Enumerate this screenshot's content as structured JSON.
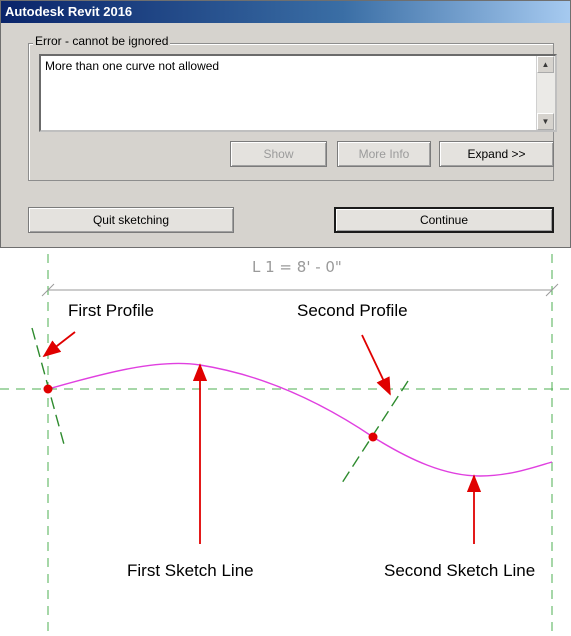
{
  "dialog": {
    "title": "Autodesk Revit 2016",
    "group_label": "Error - cannot be ignored",
    "message": "More than one curve not allowed",
    "scroll_up_glyph": "▲",
    "scroll_down_glyph": "▼",
    "buttons": {
      "show": "Show",
      "more_info": "More Info",
      "expand": "Expand >>",
      "quit_sketching": "Quit sketching",
      "continue": "Continue"
    }
  },
  "drawing": {
    "dimension_label": "L 1 = 8' - 0\"",
    "callouts": {
      "first_profile": "First Profile",
      "second_profile": "Second Profile",
      "first_sketch_line": "First Sketch Line",
      "second_sketch_line": "Second Sketch Line"
    },
    "colors": {
      "curve": "#e040e0",
      "guides": "#4caf50",
      "arrows": "#e00000",
      "dimension": "#9a9a9a"
    }
  }
}
